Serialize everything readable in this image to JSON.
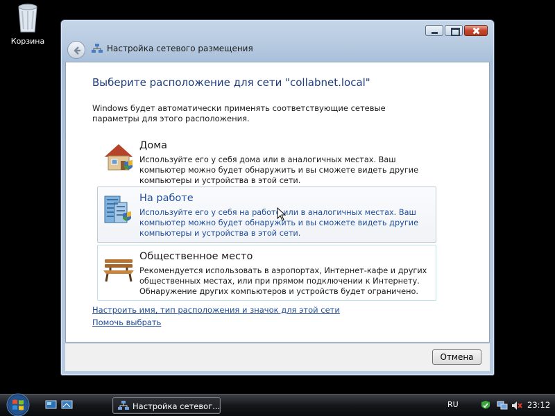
{
  "desktop": {
    "recycle_bin_label": "Корзина",
    "recycle_bin_icon": "recycle-bin-icon"
  },
  "window": {
    "title": "Настройка сетевого размещения",
    "heading": "Выберите расположение для сети \"collabnet.local\"",
    "description": "Windows будет автоматически применять соответствующие сетевые параметры для этого расположения.",
    "options": [
      {
        "title": "Дома",
        "description": "Используйте его у себя дома или в аналогичных местах. Ваш компьютер можно будет обнаружить и вы сможете видеть другие компьютеры и устройства в этой сети.",
        "icon": "home-icon"
      },
      {
        "title": "На работе",
        "description": "Используйте его у себя на работе или в аналогичных местах. Ваш компьютер можно будет обнаружить и вы сможете видеть другие компьютеры и устройства в этой сети.",
        "icon": "work-building-icon"
      },
      {
        "title": "Общественное место",
        "description": "Рекомендуется использовать в аэропортах, Интернет-кафе и других общественных местах, или при прямом подключении к Интернету. Обнаружение других компьютеров и устройств будет ограничено.",
        "icon": "public-bench-icon"
      }
    ],
    "links": {
      "customize": "Настроить имя, тип расположения и значок для этой сети",
      "help": "Помочь выбрать"
    },
    "cancel_label": "Отмена",
    "accent_color": "#1f4d9a"
  },
  "taskbar": {
    "active_task_label": "Настройка сетевог...",
    "language": "RU",
    "clock": "23:12"
  }
}
